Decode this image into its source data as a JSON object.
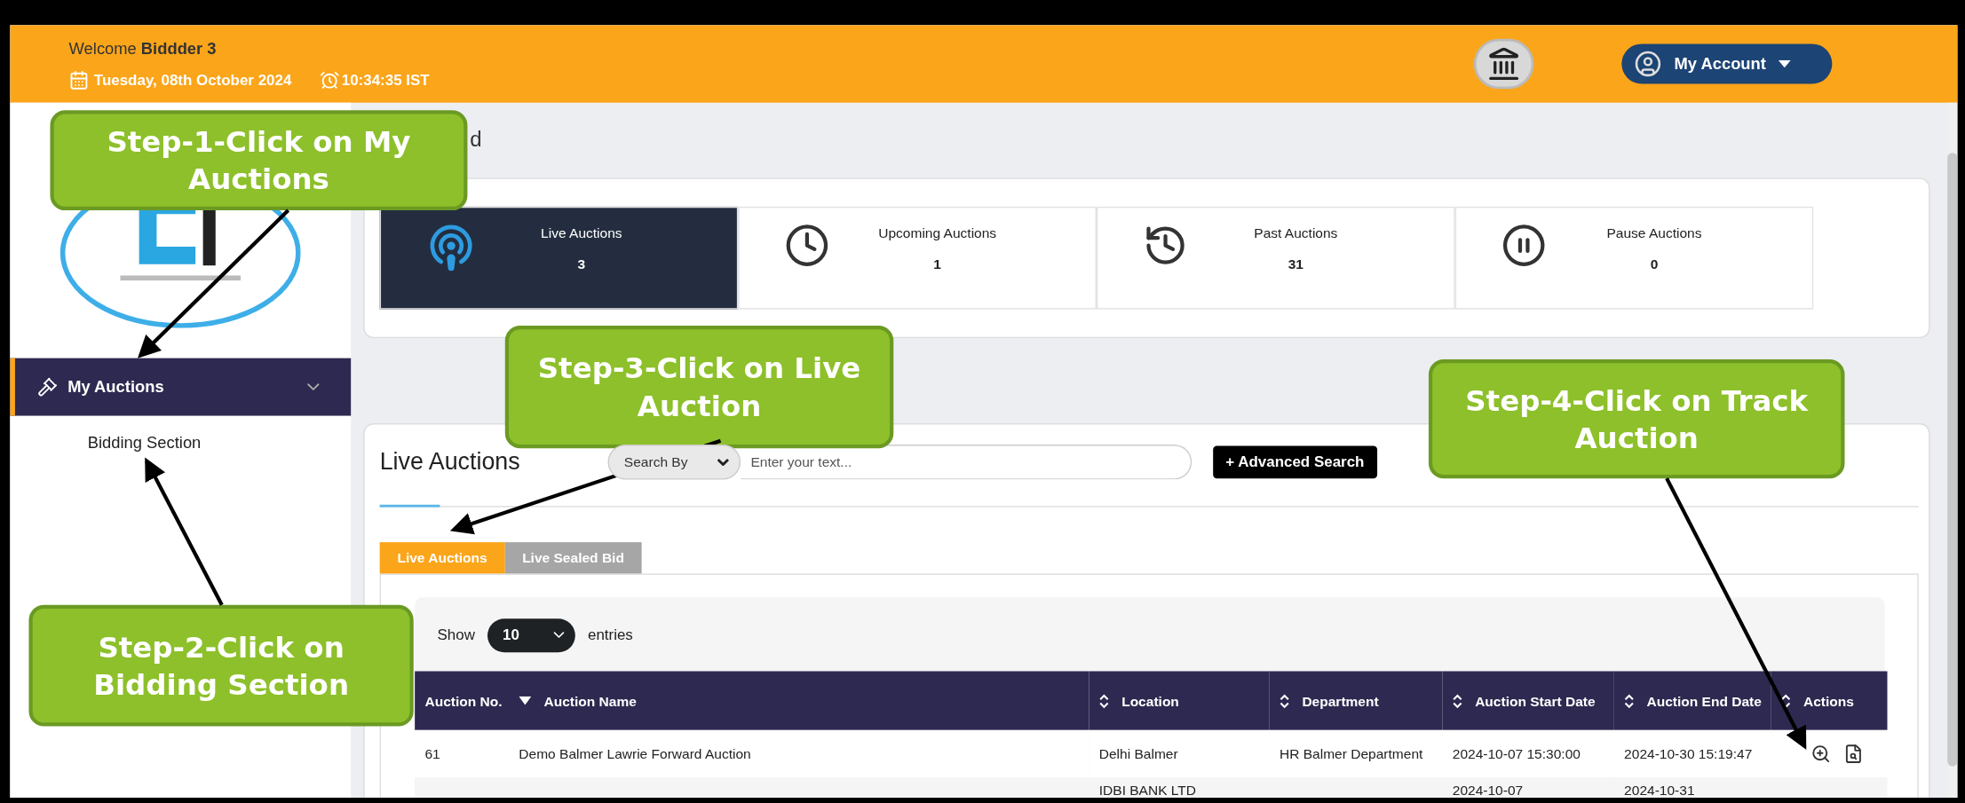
{
  "header": {
    "welcome": "Welcome **Biddder 3**",
    "date": "Tuesday, 08th October 2024",
    "time": "10:34:35 IST",
    "account_button": "My Account"
  },
  "breadcrumb": "d",
  "stats": [
    {
      "kind": "live",
      "label": "Live Auctions",
      "count": "3",
      "selected": true
    },
    {
      "kind": "upcoming",
      "label": "Upcoming Auctions",
      "count": "1",
      "selected": false
    },
    {
      "kind": "past",
      "label": "Past Auctions",
      "count": "31",
      "selected": false
    },
    {
      "kind": "pause",
      "label": "Pause Auctions",
      "count": "0",
      "selected": false
    }
  ],
  "sidebar": {
    "items": [
      {
        "label": "My Auctions",
        "expanded": true,
        "children": [
          {
            "label": "Bidding Section"
          }
        ]
      }
    ]
  },
  "live_panel": {
    "title": "Live Auctions",
    "search_by": "Search By",
    "search_placeholder": "Enter your text...",
    "advanced_button": "+ Advanced Search",
    "tabs": [
      {
        "label": "Live Auctions",
        "selected": true
      },
      {
        "label": "Live Sealed Bid",
        "selected": false
      }
    ],
    "show_label": "Show",
    "page_size": "10",
    "entries_label": "entries",
    "columns": [
      {
        "label": "Auction No.",
        "sortable": false
      },
      {
        "label": "Auction Name",
        "sortable": true,
        "sorted": true
      },
      {
        "label": "Location",
        "sortable": true,
        "sorted": false
      },
      {
        "label": "Department",
        "sortable": true,
        "sorted": false
      },
      {
        "label": "Auction Start Date",
        "sortable": true,
        "sorted": false
      },
      {
        "label": "Auction End Date",
        "sortable": true,
        "sorted": false
      },
      {
        "label": "Actions",
        "sortable": true,
        "sorted": false
      }
    ],
    "rows": [
      {
        "cells": [
          "61",
          "Demo Balmer Lawrie Forward Auction",
          "Delhi Balmer",
          "HR Balmer Department",
          "2024-10-07 15:30:00",
          "2024-10-30 15:19:47"
        ],
        "actions": true
      },
      {
        "cells": [
          "",
          "",
          "IDBI BANK LTD",
          "",
          "2024-10-07",
          "2024-10-31"
        ],
        "actions": false
      }
    ]
  },
  "callouts": [
    {
      "text": "Step-1-Click on My Auctions"
    },
    {
      "text": "Step-2-Click on Bidding Section"
    },
    {
      "text": "Step-3-Click on Live Auction"
    },
    {
      "text": "Step-4-Click on Track Auction"
    }
  ]
}
